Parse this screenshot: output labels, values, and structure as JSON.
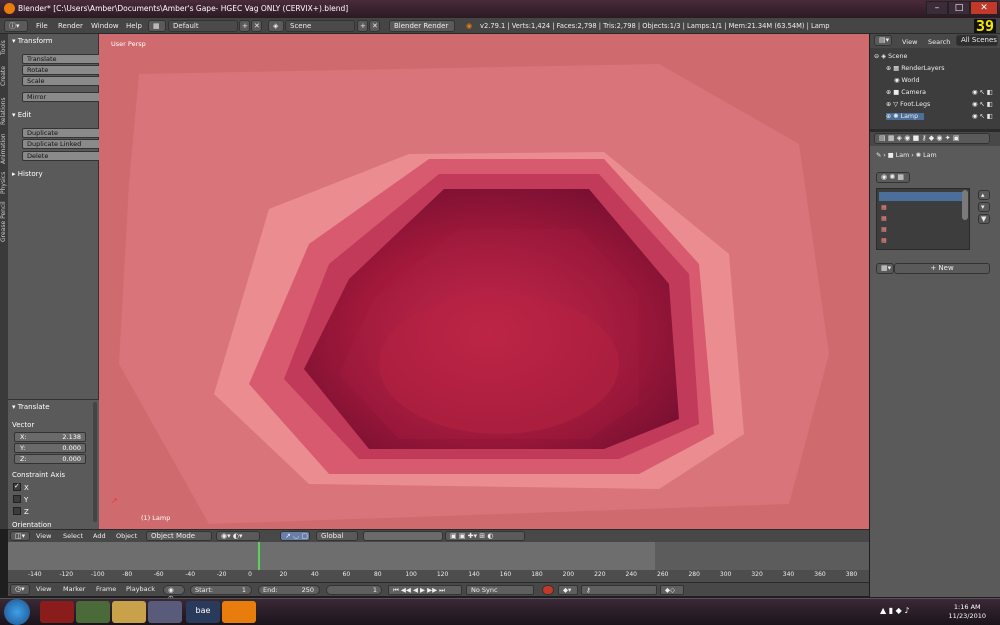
{
  "window": {
    "title": "Blender* [C:\\Users\\Amber\\Documents\\Amber's Gape- HGEC Vag ONLY (CERVIX+).blend]"
  },
  "infobar": {
    "menus": [
      "File",
      "Render",
      "Window",
      "Help"
    ],
    "layout": "Default",
    "scene": "Scene",
    "engine": "Blender Render",
    "stats": "v2.79.1 | Verts:1,424 | Faces:2,798 | Tris:2,798 | Objects:1/3 | Lamps:1/1 | Mem:21.34M (63.54M) | Lamp",
    "fps": "39"
  },
  "tabs": [
    "Tools",
    "Create",
    "Relations",
    "Animation",
    "Physics",
    "Grease Pencil"
  ],
  "toolshelf": {
    "transform_title": "Transform",
    "transform_buttons": [
      "Translate",
      "Rotate",
      "Scale"
    ],
    "mirror": "Mirror",
    "edit_title": "Edit",
    "edit_buttons": [
      "Duplicate",
      "Duplicate Linked",
      "Delete"
    ],
    "history_title": "History"
  },
  "operator": {
    "title": "Translate",
    "vector_label": "Vector",
    "x_label": "X:",
    "x_value": "2.138",
    "y_label": "Y:",
    "y_value": "0.000",
    "z_label": "Z:",
    "z_value": "0.000",
    "constraint_label": "Constraint Axis",
    "axes": [
      "X",
      "Y",
      "Z"
    ],
    "orientation_label": "Orientation"
  },
  "viewport": {
    "view_label": "User Persp",
    "object_label": "(1) Lamp"
  },
  "viewheader": {
    "menus": [
      "View",
      "Select",
      "Add",
      "Object"
    ],
    "mode": "Object Mode",
    "orientation": "Global"
  },
  "timeline": {
    "ticks": [
      "-140",
      "-120",
      "-100",
      "-80",
      "-60",
      "-40",
      "-20",
      "0",
      "20",
      "40",
      "60",
      "80",
      "100",
      "120",
      "140",
      "160",
      "180",
      "200",
      "220",
      "240",
      "260",
      "280",
      "300",
      "320",
      "340",
      "360",
      "380"
    ],
    "menus": [
      "View",
      "Marker",
      "Frame",
      "Playback"
    ],
    "start_label": "Start:",
    "start_value": "1",
    "end_label": "End:",
    "end_value": "250",
    "current_frame": "1",
    "sync": "No Sync"
  },
  "outliner": {
    "tabs": [
      "View",
      "Search",
      "All Scenes"
    ],
    "items": [
      "Scene",
      "RenderLayers",
      "World",
      "Camera",
      "Foot.Legs",
      "Lamp"
    ]
  },
  "properties": {
    "breadcrumb_1": "Lam",
    "breadcrumb_2": "Lam",
    "new_button": "New"
  },
  "taskbar": {
    "app_label": "bae",
    "time": "1:16 AM",
    "date": "11/23/2010"
  },
  "colors": {
    "accent": "#f5e400",
    "viewport_base": "#d2696c",
    "timeline_cursor": "#5ad35a"
  }
}
